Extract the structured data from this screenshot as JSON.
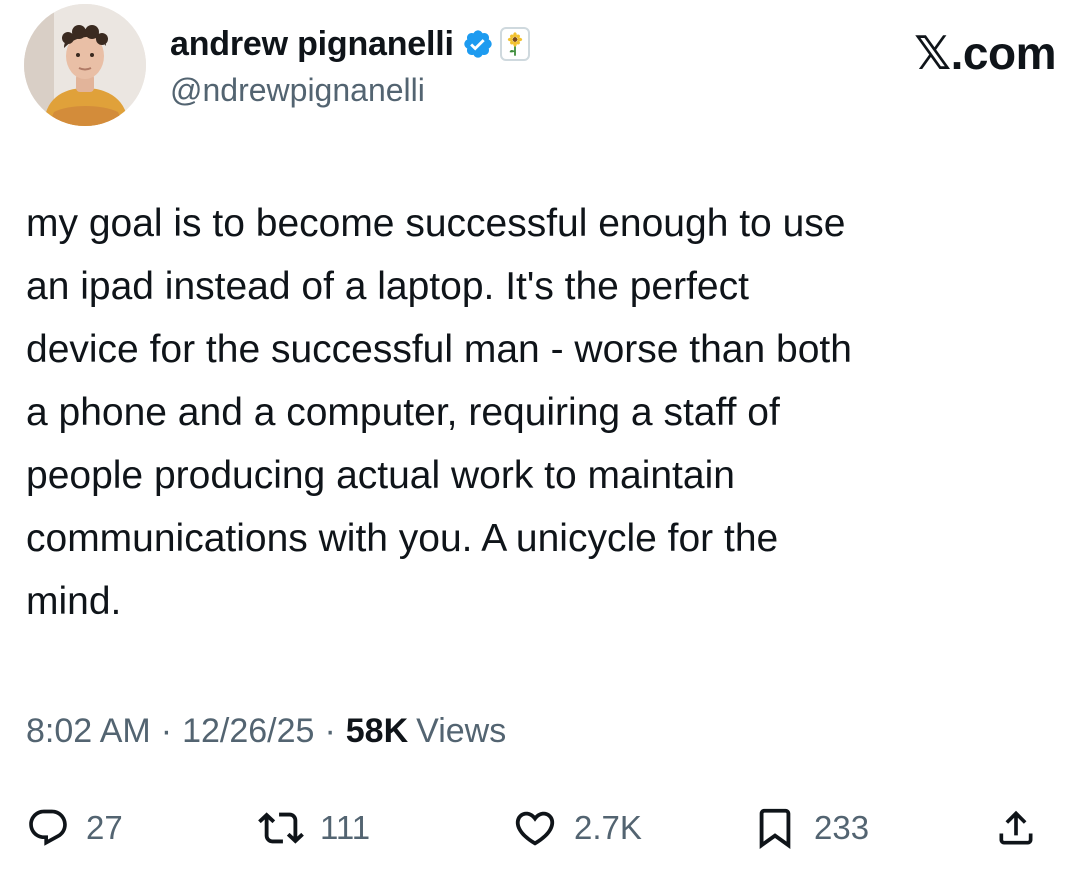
{
  "tweet": {
    "author": {
      "display_name": "andrew pignanelli",
      "handle": "@ndrewpignanelli",
      "verified_icon": "verified-badge-icon",
      "affiliate_icon": "sunflower-icon"
    },
    "brand": "𝕏.com",
    "text": "my goal is to become successful enough to use\nan ipad instead of a laptop.  It's the perfect\ndevice for the successful man - worse than both\na phone and a computer, requiring a staff of\npeople producing actual work to maintain\ncommunications with you. A unicycle for the\nmind.",
    "time": "8:02 AM",
    "date": "12/26/25",
    "separator": "·",
    "views_count": "58K",
    "views_label": "Views",
    "actions": {
      "replies": "27",
      "reposts": "111",
      "likes": "2.7K",
      "bookmarks": "233"
    }
  },
  "colors": {
    "text_primary": "#0f1419",
    "text_secondary": "#536471",
    "verified_blue": "#1d9bf0"
  }
}
